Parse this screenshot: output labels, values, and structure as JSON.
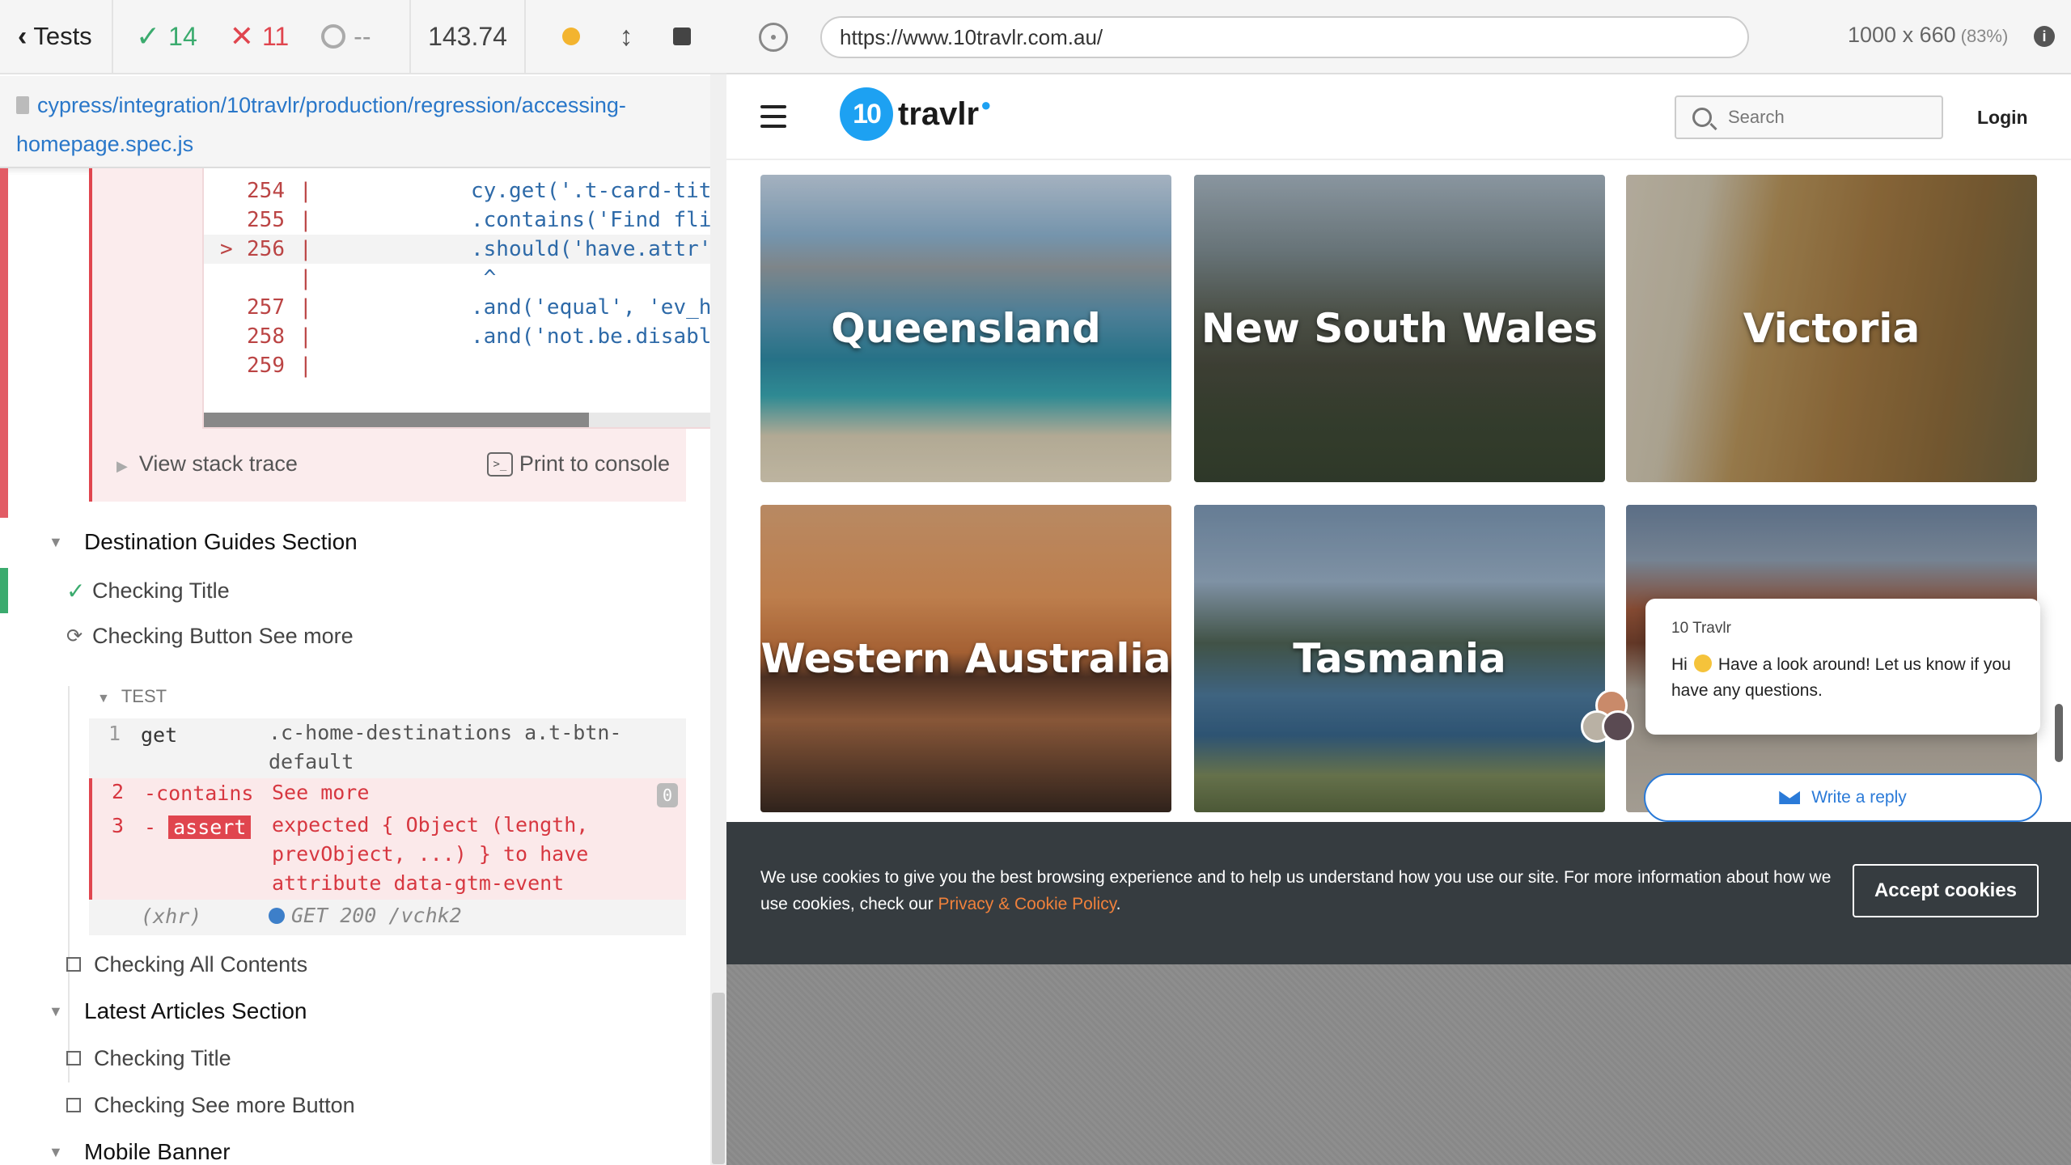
{
  "reporter": {
    "tests_label": "Tests",
    "passed": "14",
    "failed": "11",
    "pending": "--",
    "duration": "143.74",
    "spec_path": "cypress/integration/10travlr/production/regression/accessing-homepage.spec.js",
    "code_lines": [
      {
        "num": "254",
        "code": "cy.get('.t-card-title-co"
      },
      {
        "num": "255",
        "code": ".contains('Find flights'"
      },
      {
        "num": "256",
        "code": ".should('have.attr', 'da"
      },
      {
        "num": "",
        "code": " ^"
      },
      {
        "num": "257",
        "code": ".and('equal', 'ev_homepa"
      },
      {
        "num": "258",
        "code": ".and('not.be.disabled')"
      },
      {
        "num": "259",
        "code": ""
      }
    ],
    "error_marker": ">",
    "view_stack_trace": "View stack trace",
    "print_to_console": "Print to console",
    "suite_destination": "Destination Guides Section",
    "test_checking_title": "Checking Title",
    "test_checking_button": "Checking Button See more",
    "test_header": "TEST",
    "commands": [
      {
        "num": "1",
        "name": "get",
        "msg": ".c-home-destinations a.t-btn-default"
      },
      {
        "num": "2",
        "name": "-contains",
        "msg": "See more",
        "badge": "0"
      },
      {
        "num": "3",
        "name": "assert",
        "msg": "expected { Object (length, prevObject, ...) } to have attribute data-gtm-event"
      },
      {
        "num": "",
        "name": "(xhr)",
        "msg": "GET 200 /vchk2"
      }
    ],
    "test_checking_all": "Checking All Contents",
    "suite_articles": "Latest Articles Section",
    "test_articles_title": "Checking Title",
    "test_articles_see_more": "Checking See more Button",
    "suite_mobile": "Mobile Banner"
  },
  "aut": {
    "url": "https://www.10travlr.com.au/",
    "viewport": "1000 x 660",
    "scale": "(83%)"
  },
  "site": {
    "logo_num": "10",
    "logo_text": "travlr",
    "search_placeholder": "Search",
    "login": "Login",
    "destinations": [
      "Queensland",
      "New South Wales",
      "Victoria",
      "Western Australia",
      "Tasmania",
      ""
    ],
    "chat": {
      "from": "10 Travlr",
      "greeting": "Hi",
      "message": "Have a look around! Let us know if you have any questions.",
      "reply": "Write a reply"
    },
    "cookie": {
      "text": "We use cookies to give you the best browsing experience and to help us understand how you use our site. For more information about how we use cookies, check our",
      "link": "Privacy & Cookie Policy",
      "end": ".",
      "accept": "Accept cookies"
    }
  },
  "colors": {
    "pass": "#3bab6e",
    "fail": "#e0454e",
    "link": "#2977c9",
    "brand": "#1da1f2",
    "cookie_link": "#f0813b"
  }
}
